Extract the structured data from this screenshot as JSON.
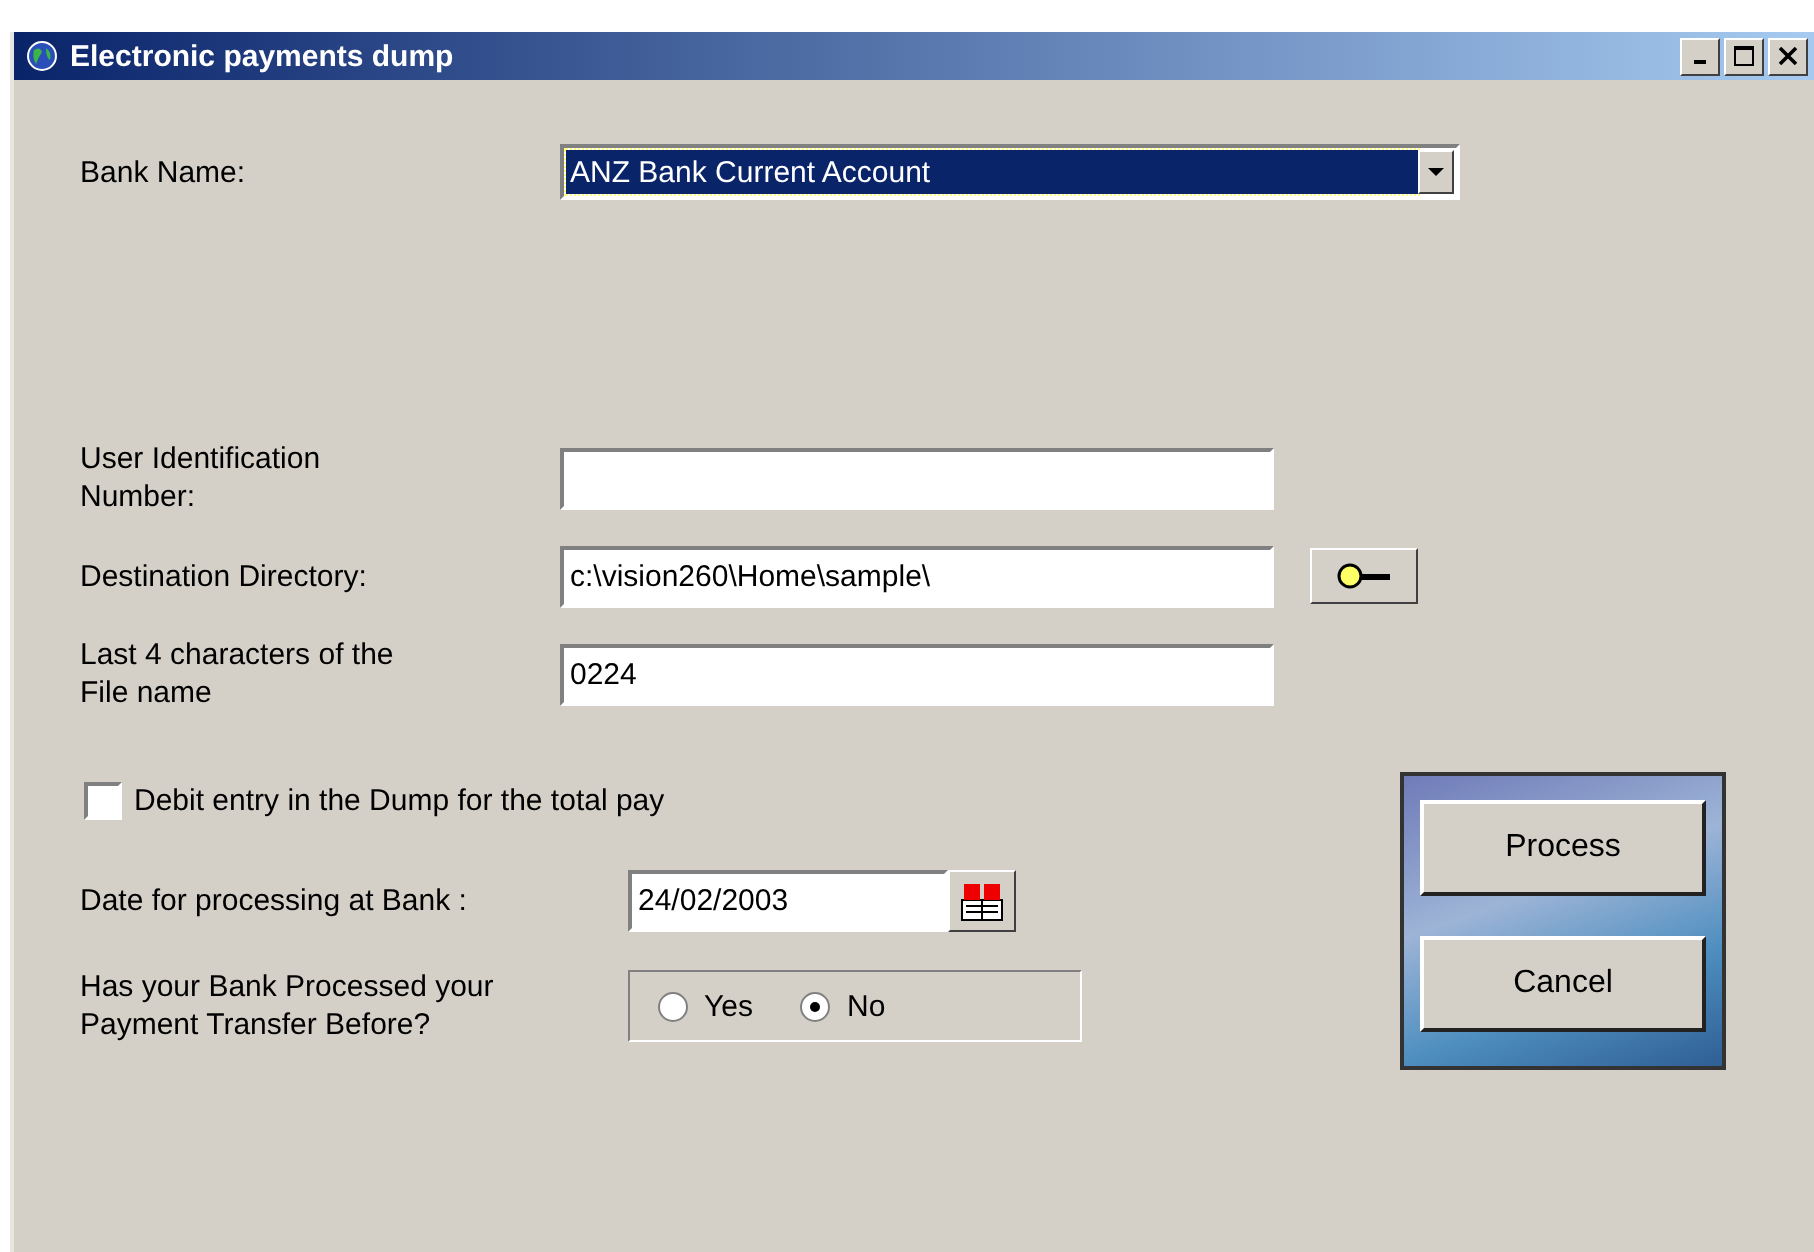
{
  "window": {
    "title": "Electronic payments dump"
  },
  "bank_name": {
    "label": "Bank Name:",
    "value": "ANZ Bank Current Account"
  },
  "fields": [
    {
      "kind": "text",
      "label": "User Identification Number:"
    },
    {
      "kind": "browse",
      "label": "Destination Directory:",
      "value": "c:\\vision260\\Home\\sample\\"
    },
    {
      "kind": "text",
      "label": "Last 4 characters of the File name",
      "value": "0224"
    }
  ],
  "debit_checkbox": {
    "label": "Debit entry in the Dump for the total pay",
    "checked": false
  },
  "date": {
    "label": "Date for processing at Bank :",
    "value": "24/02/2003"
  },
  "processed_before": {
    "label": "Has your Bank Processed your Payment Transfer Before?",
    "options": [
      {
        "label": "Yes",
        "selected": false
      },
      {
        "label": "No",
        "selected": true
      }
    ]
  },
  "buttons": [
    "Process",
    "Cancel"
  ]
}
